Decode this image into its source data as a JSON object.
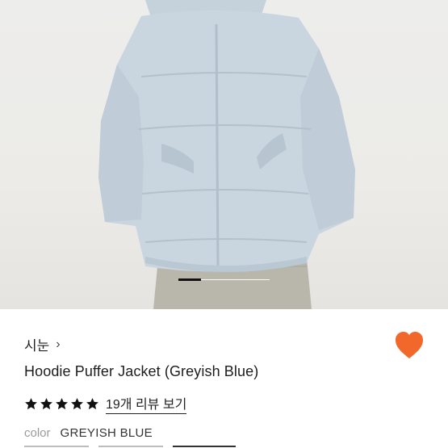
{
  "product": {
    "brand": "시눈",
    "brand_chevron": "›",
    "name": "Hoodie Puffer Jacket (Greyish Blue)",
    "rating": 5,
    "rating_max": 5,
    "review_link": "19개 리뷰 보기",
    "color_label": "color",
    "color_value": "GREYISH BLUE",
    "favorited": true
  },
  "gallery": {
    "current_index": 1,
    "active_fraction": 0.25
  },
  "colors": {
    "heart": "#f2672a",
    "star": "#111111",
    "jacket": "#c9d6e0"
  }
}
